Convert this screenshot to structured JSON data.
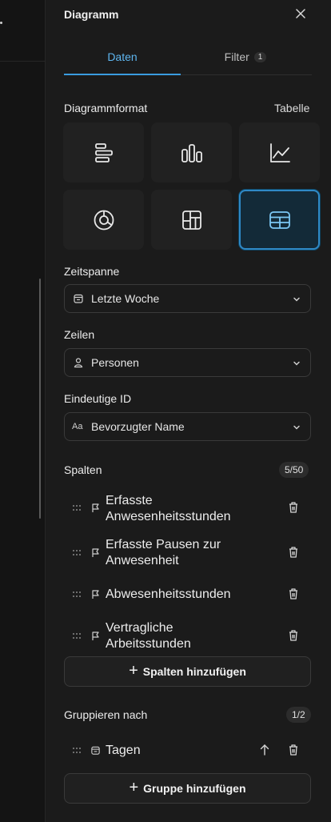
{
  "panel": {
    "title": "Diagramm"
  },
  "tabs": [
    {
      "label": "Daten"
    },
    {
      "label": "Filter",
      "badge": "1"
    }
  ],
  "format": {
    "label": "Diagrammformat",
    "value": "Tabelle"
  },
  "tiles": [
    {
      "icon": "horizontal-bar-chart-icon"
    },
    {
      "icon": "bar-chart-icon"
    },
    {
      "icon": "line-chart-icon"
    },
    {
      "icon": "donut-chart-icon"
    },
    {
      "icon": "treemap-icon"
    },
    {
      "icon": "table-icon",
      "selected": true
    }
  ],
  "zeitspanne": {
    "label": "Zeitspanne",
    "value": "Letzte Woche",
    "icon": "calendar-icon"
  },
  "zeilen": {
    "label": "Zeilen",
    "value": "Personen",
    "icon": "person-icon"
  },
  "eindeutige_id": {
    "label": "Eindeutige ID",
    "value": "Bevorzugter Name",
    "icon": "text-aa-icon",
    "icon_text": "Aa"
  },
  "spalten": {
    "label": "Spalten",
    "count": "5/50",
    "items": [
      {
        "line1": "Erfasste",
        "line2": "Anwesenheitsstunden"
      },
      {
        "line1": "Erfasste Pausen zur",
        "line2": "Anwesenheit"
      },
      {
        "line1": "Abwesenheitsstunden",
        "line2": ""
      },
      {
        "line1": "Vertragliche",
        "line2": "Arbeitsstunden"
      }
    ],
    "add_label": "Spalten hinzufügen"
  },
  "gruppieren": {
    "label": "Gruppieren nach",
    "count": "1/2",
    "items": [
      {
        "label": "Tagen"
      }
    ],
    "add_label": "Gruppe hinzufügen"
  },
  "colors": {
    "accent": "#3a9ce0",
    "background": "#1b1b1b"
  }
}
